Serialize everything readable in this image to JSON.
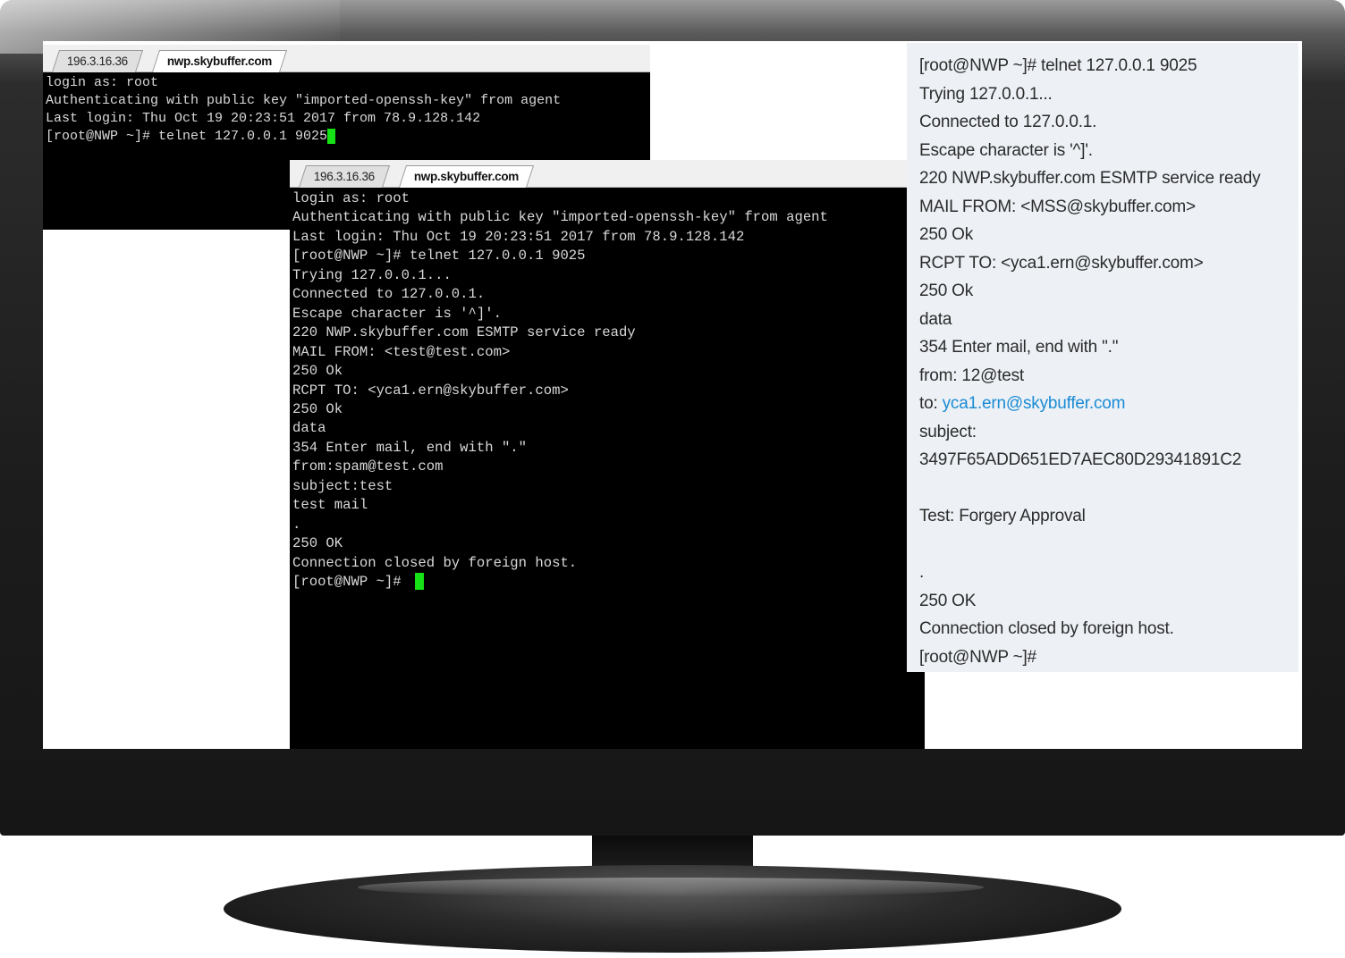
{
  "back_window": {
    "tabs": [
      {
        "label": "196.3.16.36",
        "active": false
      },
      {
        "label": "nwp.skybuffer.com",
        "active": true
      }
    ],
    "lines": [
      "login as: root",
      "Authenticating with public key \"imported-openssh-key\" from agent",
      "Last login: Thu Oct 19 20:23:51 2017 from 78.9.128.142",
      "[root@NWP ~]# telnet 127.0.0.1 9025"
    ]
  },
  "front_window": {
    "tabs": [
      {
        "label": "196.3.16.36",
        "active": false
      },
      {
        "label": "nwp.skybuffer.com",
        "active": true
      }
    ],
    "lines": [
      "login as: root",
      "Authenticating with public key \"imported-openssh-key\" from agent",
      "Last login: Thu Oct 19 20:23:51 2017 from 78.9.128.142",
      "[root@NWP ~]# telnet 127.0.0.1 9025",
      "Trying 127.0.0.1...",
      "Connected to 127.0.0.1.",
      "Escape character is '^]'.",
      "220 NWP.skybuffer.com ESMTP service ready",
      "MAIL FROM: <test@test.com>",
      "250 Ok",
      "RCPT TO: <yca1.ern@skybuffer.com>",
      "250 Ok",
      "data",
      "354 Enter mail, end with \".\"",
      "from:spam@test.com",
      "subject:test",
      "test mail",
      ".",
      "250 OK",
      "Connection closed by foreign host.",
      "[root@NWP ~]# "
    ]
  },
  "transcript": {
    "lines": [
      "[root@NWP ~]# telnet 127.0.0.1 9025",
      "Trying 127.0.0.1...",
      "Connected to 127.0.0.1.",
      "Escape character is '^]'.",
      "220 NWP.skybuffer.com ESMTP service ready",
      "MAIL FROM: <MSS@skybuffer.com>",
      "250 Ok",
      "RCPT TO: <yca1.ern@skybuffer.com>",
      "250 Ok",
      "data",
      "354 Enter mail, end with \".\"",
      "from: 12@test",
      "to: ",
      "subject:",
      "3497F65ADD651ED7AEC80D29341891C2",
      "",
      "Test: Forgery Approval",
      "",
      ".",
      "250 OK",
      "Connection closed by foreign host.",
      "[root@NWP ~]#"
    ],
    "to_link": "yca1.ern@skybuffer.com"
  },
  "colors": {
    "cursor": "#16e016",
    "link": "#1a8bd4",
    "terminal_bg": "#000000",
    "transcript_bg": "#edf1f6"
  },
  "icons": {
    "cursor": "terminal-block-cursor-icon"
  }
}
